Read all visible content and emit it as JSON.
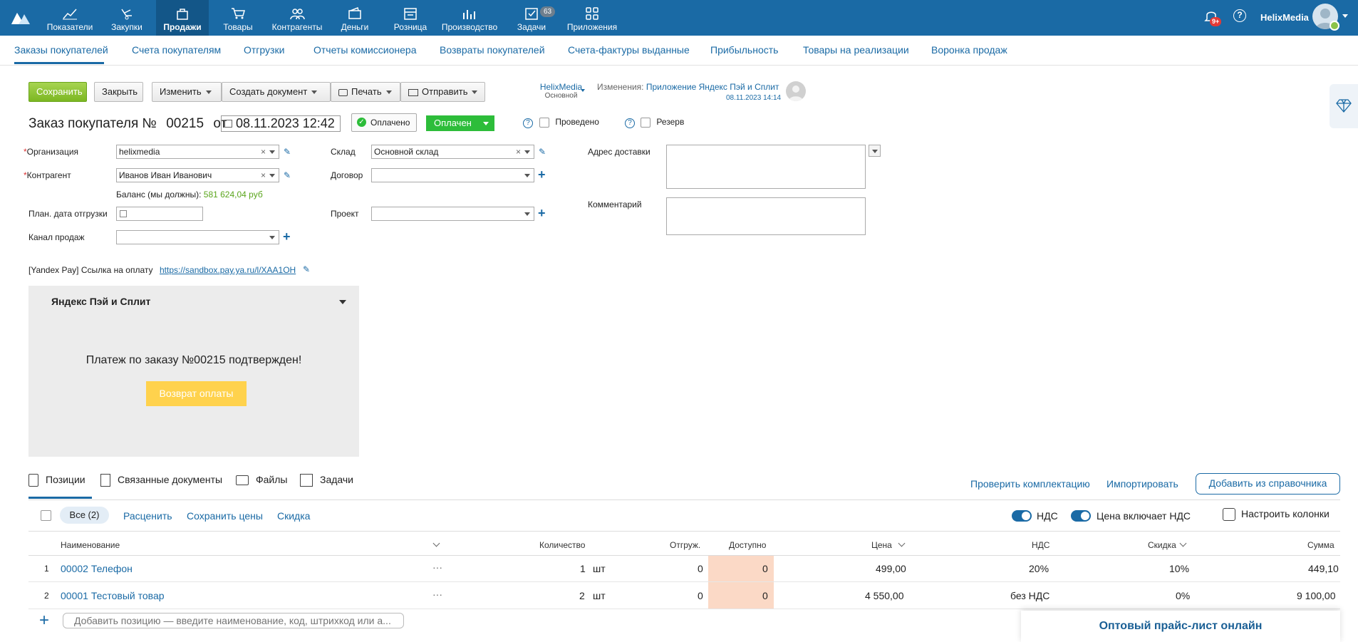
{
  "nav": {
    "items": [
      {
        "label": "Показатели",
        "icon": "chart-line-icon"
      },
      {
        "label": "Закупки",
        "icon": "hand-cart-icon"
      },
      {
        "label": "Продажи",
        "icon": "shopping-bag-icon"
      },
      {
        "label": "Товары",
        "icon": "cart-icon"
      },
      {
        "label": "Контрагенты",
        "icon": "people-icon"
      },
      {
        "label": "Деньги",
        "icon": "wallet-icon"
      },
      {
        "label": "Розница",
        "icon": "store-icon"
      },
      {
        "label": "Производство",
        "icon": "factory-icon"
      },
      {
        "label": "Задачи",
        "icon": "task-check-icon"
      },
      {
        "label": "Приложения",
        "icon": "apps-grid-icon"
      }
    ],
    "tasks_badge": "63",
    "notif_badge": "9+",
    "user": "HelixMedia",
    "help": "?"
  },
  "subnav": {
    "items": [
      "Заказы покупателей",
      "Счета покупателям",
      "Отгрузки",
      "Отчеты комиссионера",
      "Возвраты покупателей",
      "Счета-фактуры выданные",
      "Прибыльность",
      "Товары на реализации",
      "Воронка продаж"
    ]
  },
  "toolbar": {
    "save": "Сохранить",
    "close": "Закрыть",
    "change": "Изменить",
    "create_doc": "Создать документ",
    "print": "Печать",
    "send": "Отправить"
  },
  "owner": {
    "name": "HelixMedia",
    "sub": "Основной"
  },
  "changes": {
    "label": "Изменения:",
    "link": "Приложение Яндекс Пэй и Сплит",
    "date": "08.11.2023 14:14"
  },
  "doc": {
    "title": "Заказ покупателя №",
    "number": "00215",
    "from": "от",
    "date": "08.11.2023 12:42",
    "paid_badge": "Оплачено",
    "status": "Оплачен",
    "posted": "Проведено",
    "reserve": "Резерв"
  },
  "form": {
    "org_label": "Организация",
    "org_value": "helixmedia",
    "contractor_label": "Контрагент",
    "contractor_value": "Иванов Иван Иванович",
    "balance_label": "Баланс (мы должны):",
    "balance_value": "581 624,04 руб",
    "ship_date_label": "План. дата отгрузки",
    "channel_label": "Канал продаж",
    "warehouse_label": "Склад",
    "warehouse_value": "Основной склад",
    "contract_label": "Договор",
    "project_label": "Проект",
    "address_label": "Адрес доставки",
    "comment_label": "Комментарий",
    "required_mark": "*"
  },
  "yandex": {
    "link_label": "[Yandex Pay] Ссылка на оплату",
    "link": "https://sandbox.pay.ya.ru/l/XAA1OH",
    "panel_title": "Яндекс Пэй и Сплит",
    "message": "Платеж по заказу №00215 подтвержден!",
    "refund": "Возврат оплаты"
  },
  "tabs": {
    "positions": "Позиции",
    "related": "Связанные документы",
    "files": "Файлы",
    "tasks": "Задачи",
    "check": "Проверить комплектацию",
    "import": "Импортировать",
    "add_from_ref": "Добавить из справочника"
  },
  "filters": {
    "all": "Все (2)",
    "reprice": "Расценить",
    "save_prices": "Сохранить цены",
    "discount": "Скидка",
    "vat": "НДС",
    "price_incl_vat": "Цена включает НДС",
    "columns": "Настроить колонки"
  },
  "table": {
    "headers": {
      "name": "Наименование",
      "qty": "Количество",
      "shipped": "Отгруж.",
      "available": "Доступно",
      "price": "Цена",
      "vat": "НДС",
      "discount": "Скидка",
      "sum": "Сумма"
    },
    "rows": [
      {
        "n": "1",
        "name": "00002 Телефон",
        "more": "···",
        "qty": "1",
        "unit": "шт",
        "shipped": "0",
        "available": "0",
        "price": "499,00",
        "vat": "20%",
        "discount": "10%",
        "sum": "449,10"
      },
      {
        "n": "2",
        "name": "00001 Тестовый товар",
        "more": "···",
        "qty": "2",
        "unit": "шт",
        "shipped": "0",
        "available": "0",
        "price": "4 550,00",
        "vat": "без НДС",
        "discount": "0%",
        "sum": "9 100,00"
      }
    ],
    "add_placeholder": "Добавить позицию — введите наименование, код, штрихкод или а..."
  },
  "promo": {
    "text": "Оптовый прайс-лист онлайн"
  },
  "colors": {
    "brand": "#1a6aa5",
    "accent_green": "#2dbd3a",
    "yellow": "#ffd24d",
    "available_bg": "#fbd9c6"
  }
}
